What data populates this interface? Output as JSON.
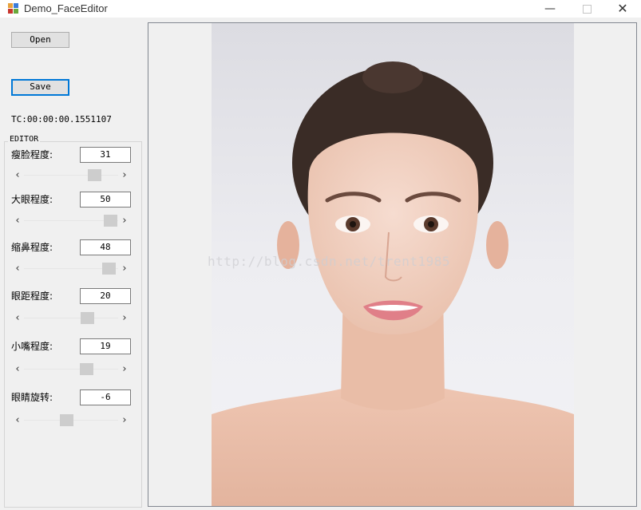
{
  "window": {
    "title": "Demo_FaceEditor",
    "minimize_glyph": "—",
    "close_glyph": "✕"
  },
  "toolbar": {
    "open_label": "Open",
    "save_label": "Save"
  },
  "timecode": "TC:00:00:00.1551107",
  "editor": {
    "group_label": "EDITOR",
    "arrow_left": "‹",
    "arrow_right": "›",
    "rows": [
      {
        "label": "瘦脸程度:",
        "value": "31"
      },
      {
        "label": "大眼程度:",
        "value": "50"
      },
      {
        "label": "缩鼻程度:",
        "value": "48"
      },
      {
        "label": "眼距程度:",
        "value": "20"
      },
      {
        "label": "小嘴程度:",
        "value": "19"
      },
      {
        "label": "眼睛旋转:",
        "value": "-6"
      }
    ]
  },
  "viewer": {
    "watermark": "http://blog.csdn.net/trent1985",
    "image_content": "portrait-photo"
  },
  "colors": {
    "accent": "#0078d7",
    "scroll_thumb": "#cdcdcd"
  }
}
